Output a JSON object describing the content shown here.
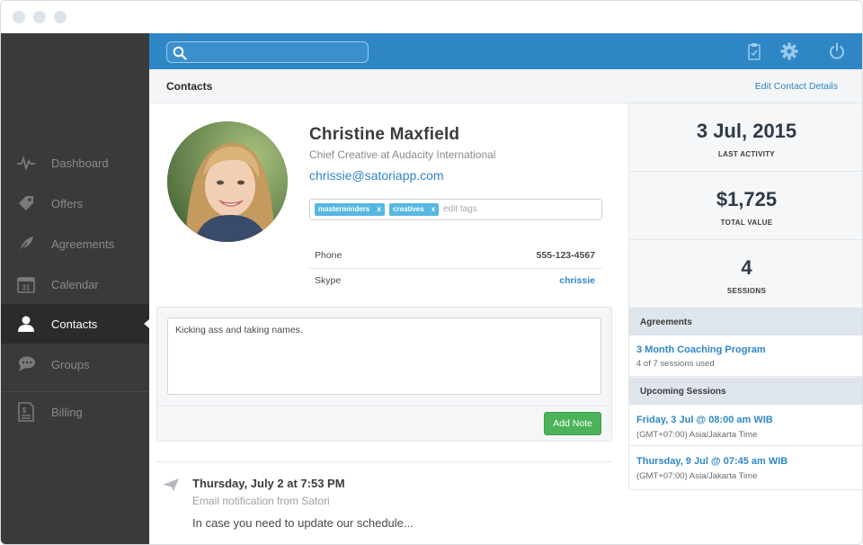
{
  "sidebar": {
    "items": [
      {
        "label": "Dashboard",
        "icon": "pulse-icon"
      },
      {
        "label": "Offers",
        "icon": "tag-icon"
      },
      {
        "label": "Agreements",
        "icon": "feather-icon"
      },
      {
        "label": "Calendar",
        "icon": "calendar-icon",
        "icon_text": "31"
      },
      {
        "label": "Contacts",
        "icon": "user-icon"
      },
      {
        "label": "Groups",
        "icon": "chat-icon"
      },
      {
        "label": "Billing",
        "icon": "invoice-icon",
        "icon_text": "$"
      }
    ],
    "active": "Contacts"
  },
  "topbar": {
    "search_placeholder": "",
    "icons": [
      "clipboard-icon",
      "gear-icon",
      "power-icon"
    ]
  },
  "header": {
    "title": "Contacts",
    "edit_link": "Edit Contact Details"
  },
  "contact": {
    "name": "Christine Maxfield",
    "job": "Chief Creative at Audacity International",
    "email": "chrissie@satoriapp.com",
    "tags": [
      {
        "label": "masterminders",
        "remove": "x"
      },
      {
        "label": "creatives",
        "remove": "x"
      }
    ],
    "tags_placeholder": "edit tags",
    "phone_label": "Phone",
    "phone_value": "555-123-4567",
    "skype_label": "Skype",
    "skype_value": "chrissie"
  },
  "note": {
    "text": "Kicking ass and taking names.",
    "button": "Add Note"
  },
  "feed": {
    "title": "Thursday, July 2 at 7:53 PM",
    "subtitle": "Email notification from Satori",
    "body": "In case you need to update our schedule..."
  },
  "stats": [
    {
      "value": "3 Jul, 2015",
      "label": "LAST ACTIVITY"
    },
    {
      "value": "$1,725",
      "label": "TOTAL VALUE"
    },
    {
      "value": "4",
      "label": "SESSIONS"
    }
  ],
  "agreements": {
    "heading": "Agreements",
    "items": [
      {
        "title": "3 Month Coaching Program",
        "sub": "4 of 7 sessions used"
      }
    ]
  },
  "sessions": {
    "heading": "Upcoming Sessions",
    "items": [
      {
        "title": "Friday, 3 Jul @ 08:00 am WIB",
        "sub": "(GMT+07:00) Asia/Jakarta Time"
      },
      {
        "title": "Thursday, 9 Jul @ 07:45 am WIB",
        "sub": "(GMT+07:00) Asia/Jakarta Time"
      }
    ]
  },
  "colors": {
    "accent": "#2f86c5",
    "sidebar": "#3a3a3a",
    "sidebar_active": "#2b2b2b",
    "tag": "#56b8e0",
    "button": "#4db35a"
  }
}
